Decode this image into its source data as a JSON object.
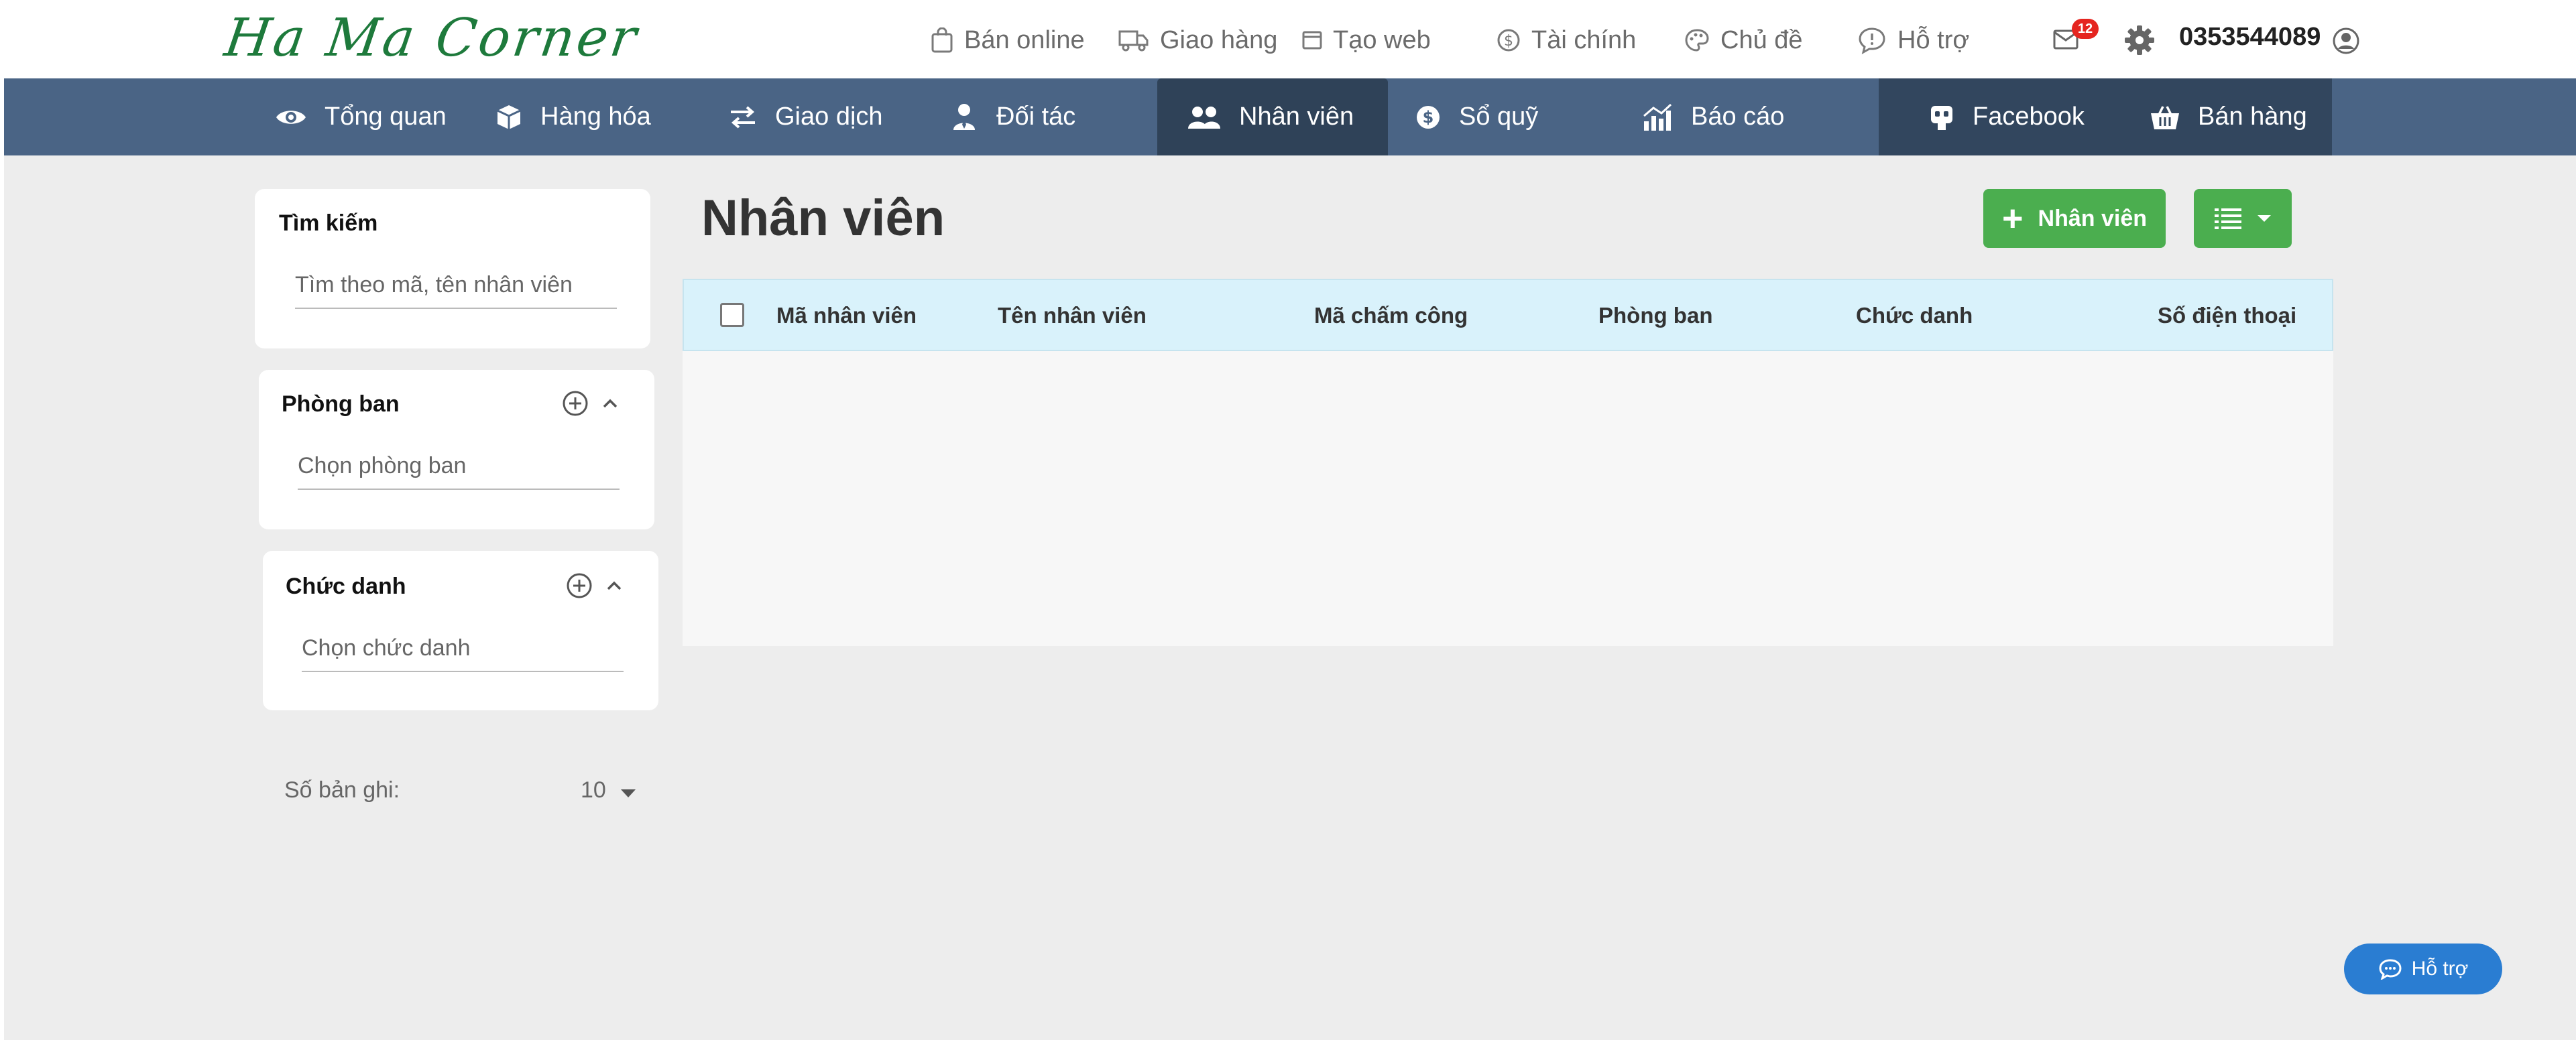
{
  "brand": {
    "logo_text": "Ha Ma Corner"
  },
  "top_links": {
    "ban_online": "Bán online",
    "giao_hang": "Giao hàng",
    "tao_web": "Tạo web",
    "tai_chinh": "Tài chính",
    "chu_de": "Chủ đề",
    "ho_tro": "Hỗ trợ"
  },
  "header": {
    "mail_count": "12",
    "phone": "0353544089"
  },
  "nav": {
    "tong_quan": "Tổng quan",
    "hang_hoa": "Hàng hóa",
    "giao_dich": "Giao dịch",
    "doi_tac": "Đối tác",
    "nhan_vien": "Nhân viên",
    "so_quy": "Sổ quỹ",
    "bao_cao": "Báo cáo",
    "facebook": "Facebook",
    "ban_hang": "Bán hàng",
    "active": "Nhân viên"
  },
  "filters": {
    "search": {
      "title": "Tìm kiếm",
      "placeholder": "Tìm theo mã, tên nhân viên"
    },
    "department": {
      "title": "Phòng ban",
      "placeholder": "Chọn phòng ban"
    },
    "position": {
      "title": "Chức danh",
      "placeholder": "Chọn chức danh"
    },
    "records": {
      "label": "Số bản ghi:",
      "value": "10"
    }
  },
  "main": {
    "page_title": "Nhân viên",
    "add_button": "Nhân viên",
    "columns": [
      "Mã nhân viên",
      "Tên nhân viên",
      "Mã chấm công",
      "Phòng ban",
      "Chức danh",
      "Số điện thoại"
    ],
    "rows": []
  },
  "support_button": "Hỗ trợ",
  "colors": {
    "nav_bg": "#4a6485",
    "nav_active": "#2f4258",
    "accent_green": "#4bae4f",
    "table_header": "#d9f2fb",
    "support_blue": "#2a7dd2",
    "badge_red": "#e52520"
  }
}
